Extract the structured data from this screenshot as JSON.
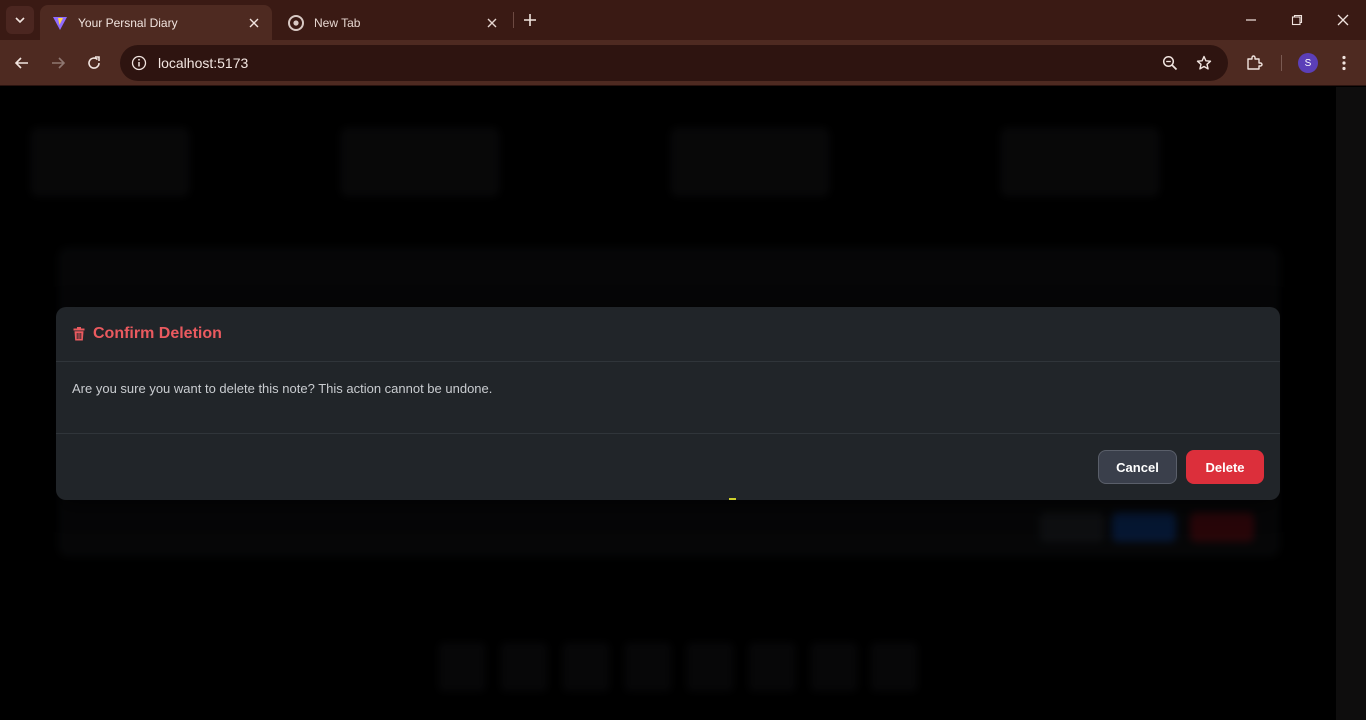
{
  "browser": {
    "tabs": [
      {
        "title": "Your Persnal Diary",
        "active": true,
        "favicon": "vite-logo-icon"
      },
      {
        "title": "New Tab",
        "active": false,
        "favicon": "chrome-icon"
      }
    ],
    "url": "localhost:5173",
    "profile_initial": "S",
    "colors": {
      "frame": "#3a1a14",
      "toolbar": "#4e2a21",
      "omnibox": "#2e1410",
      "avatar": "#5b3fb8"
    }
  },
  "modal": {
    "title": "Confirm Deletion",
    "icon": "trash-icon",
    "message": "Are you sure you want to delete this note? This action cannot be undone.",
    "cancel_label": "Cancel",
    "delete_label": "Delete",
    "colors": {
      "title": "#ea5a5f",
      "delete": "#dc2f3b",
      "cancel": "#3a3f4b",
      "background": "#212529"
    }
  }
}
